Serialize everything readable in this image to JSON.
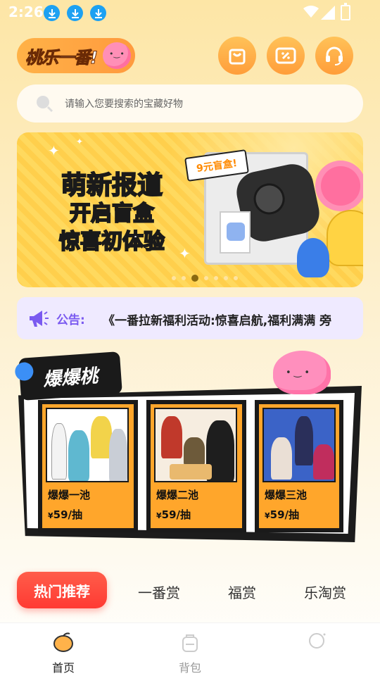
{
  "status_bar": {
    "time": "2:26",
    "download_icons": [
      "download-icon",
      "download-icon",
      "download-icon"
    ]
  },
  "header": {
    "logo_text": "桃乐一番!",
    "buttons": [
      "bag-icon",
      "coupon-icon",
      "customer-service-icon"
    ]
  },
  "search": {
    "placeholder": "请输入您要搜索的宝藏好物"
  },
  "banner": {
    "line1": "萌新报道",
    "line2": "开启盲盒",
    "line3": "惊喜初体验",
    "price_tag": "9元盲盒!",
    "active_dot_index": 2,
    "dot_count": 7
  },
  "notice": {
    "label": "公告:",
    "text": "《一番拉新福利活动:惊喜启航,福利满满 旁"
  },
  "hot_section": {
    "title": "爆爆桃",
    "pools": [
      {
        "name": "爆爆一池",
        "currency": "¥",
        "price": "59",
        "unit": "/抽"
      },
      {
        "name": "爆爆二池",
        "currency": "¥",
        "price": "59",
        "unit": "/抽"
      },
      {
        "name": "爆爆三池",
        "currency": "¥",
        "price": "59",
        "unit": "/抽"
      }
    ]
  },
  "tabs": {
    "active": "热门推荐",
    "items": [
      "一番赏",
      "福赏",
      "乐淘赏"
    ]
  },
  "bottom_nav": {
    "items": [
      {
        "label": "首页",
        "icon": "home-peach-icon",
        "active": true
      },
      {
        "label": "背包",
        "icon": "backpack-icon",
        "active": false
      },
      {
        "label": "",
        "icon": "profile-icon",
        "active": false
      }
    ]
  },
  "colors": {
    "accent": "#ff3a33",
    "brand_orange": "#ff9d3a",
    "notice_purple": "#7a5af0"
  }
}
